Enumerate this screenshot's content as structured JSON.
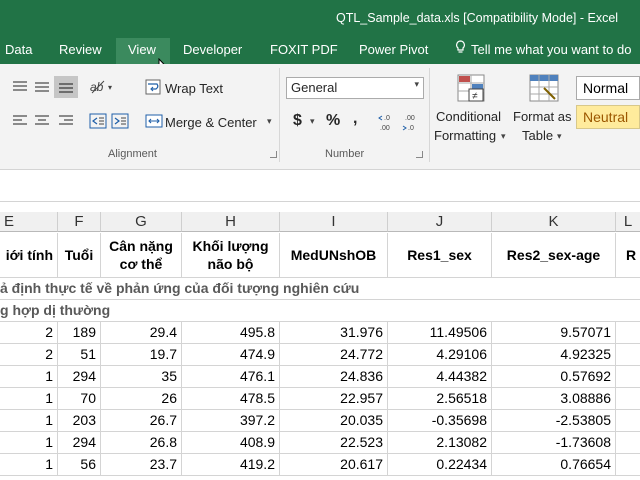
{
  "window": {
    "title": "QTL_Sample_data.xls  [Compatibility Mode] - Excel"
  },
  "tabs": [
    {
      "label": "Data"
    },
    {
      "label": "Review"
    },
    {
      "label": "View"
    },
    {
      "label": "Developer"
    },
    {
      "label": "FOXIT PDF"
    },
    {
      "label": "Power Pivot"
    }
  ],
  "tell_me": {
    "placeholder": "Tell me what you want to do",
    "icon": "lightbulb-icon"
  },
  "ribbon": {
    "alignment": {
      "label": "Alignment",
      "wrap_text": "Wrap Text",
      "merge_center": "Merge & Center"
    },
    "number": {
      "label": "Number",
      "format_value": "General",
      "currency_symbol": "$",
      "percent_symbol": "%",
      "comma_symbol": ","
    },
    "styles": {
      "conditional_formatting_line1": "Conditional",
      "conditional_formatting_line2": "Formatting",
      "format_as_table_line1": "Format as",
      "format_as_table_line2": "Table",
      "normal": "Normal",
      "neutral": "Neutral"
    }
  },
  "columns": [
    "E",
    "F",
    "G",
    "H",
    "I",
    "J",
    "K",
    "L"
  ],
  "header_row": {
    "e": "iới tính",
    "f": "Tuổi",
    "g1": "Cân nặng",
    "g2": "cơ thể",
    "h1": "Khối lượng",
    "h2": "não bộ",
    "i": "MedUNshOB",
    "j": "Res1_sex",
    "k": "Res2_sex-age",
    "l": "R"
  },
  "sections": [
    "ả định thực tế về phản ứng của đối tượng nghiên cứu",
    "g hợp dị thường"
  ],
  "rows": [
    [
      "2",
      "189",
      "29.4",
      "495.8",
      "31.976",
      "11.49506",
      "9.57071"
    ],
    [
      "2",
      "51",
      "19.7",
      "474.9",
      "24.772",
      "4.29106",
      "4.92325"
    ],
    [
      "1",
      "294",
      "35",
      "476.1",
      "24.836",
      "4.44382",
      "0.57692"
    ],
    [
      "1",
      "70",
      "26",
      "478.5",
      "22.957",
      "2.56518",
      "3.08886"
    ],
    [
      "1",
      "203",
      "26.7",
      "397.2",
      "20.035",
      "-0.35698",
      "-2.53805"
    ],
    [
      "1",
      "294",
      "26.8",
      "408.9",
      "22.523",
      "2.13082",
      "-1.73608"
    ],
    [
      "1",
      "56",
      "23.7",
      "419.2",
      "20.617",
      "0.22434",
      "0.76654"
    ]
  ],
  "colors": {
    "excel_green": "#217346",
    "neutral_fill": "#ffeb9c",
    "neutral_text": "#9c5700"
  }
}
